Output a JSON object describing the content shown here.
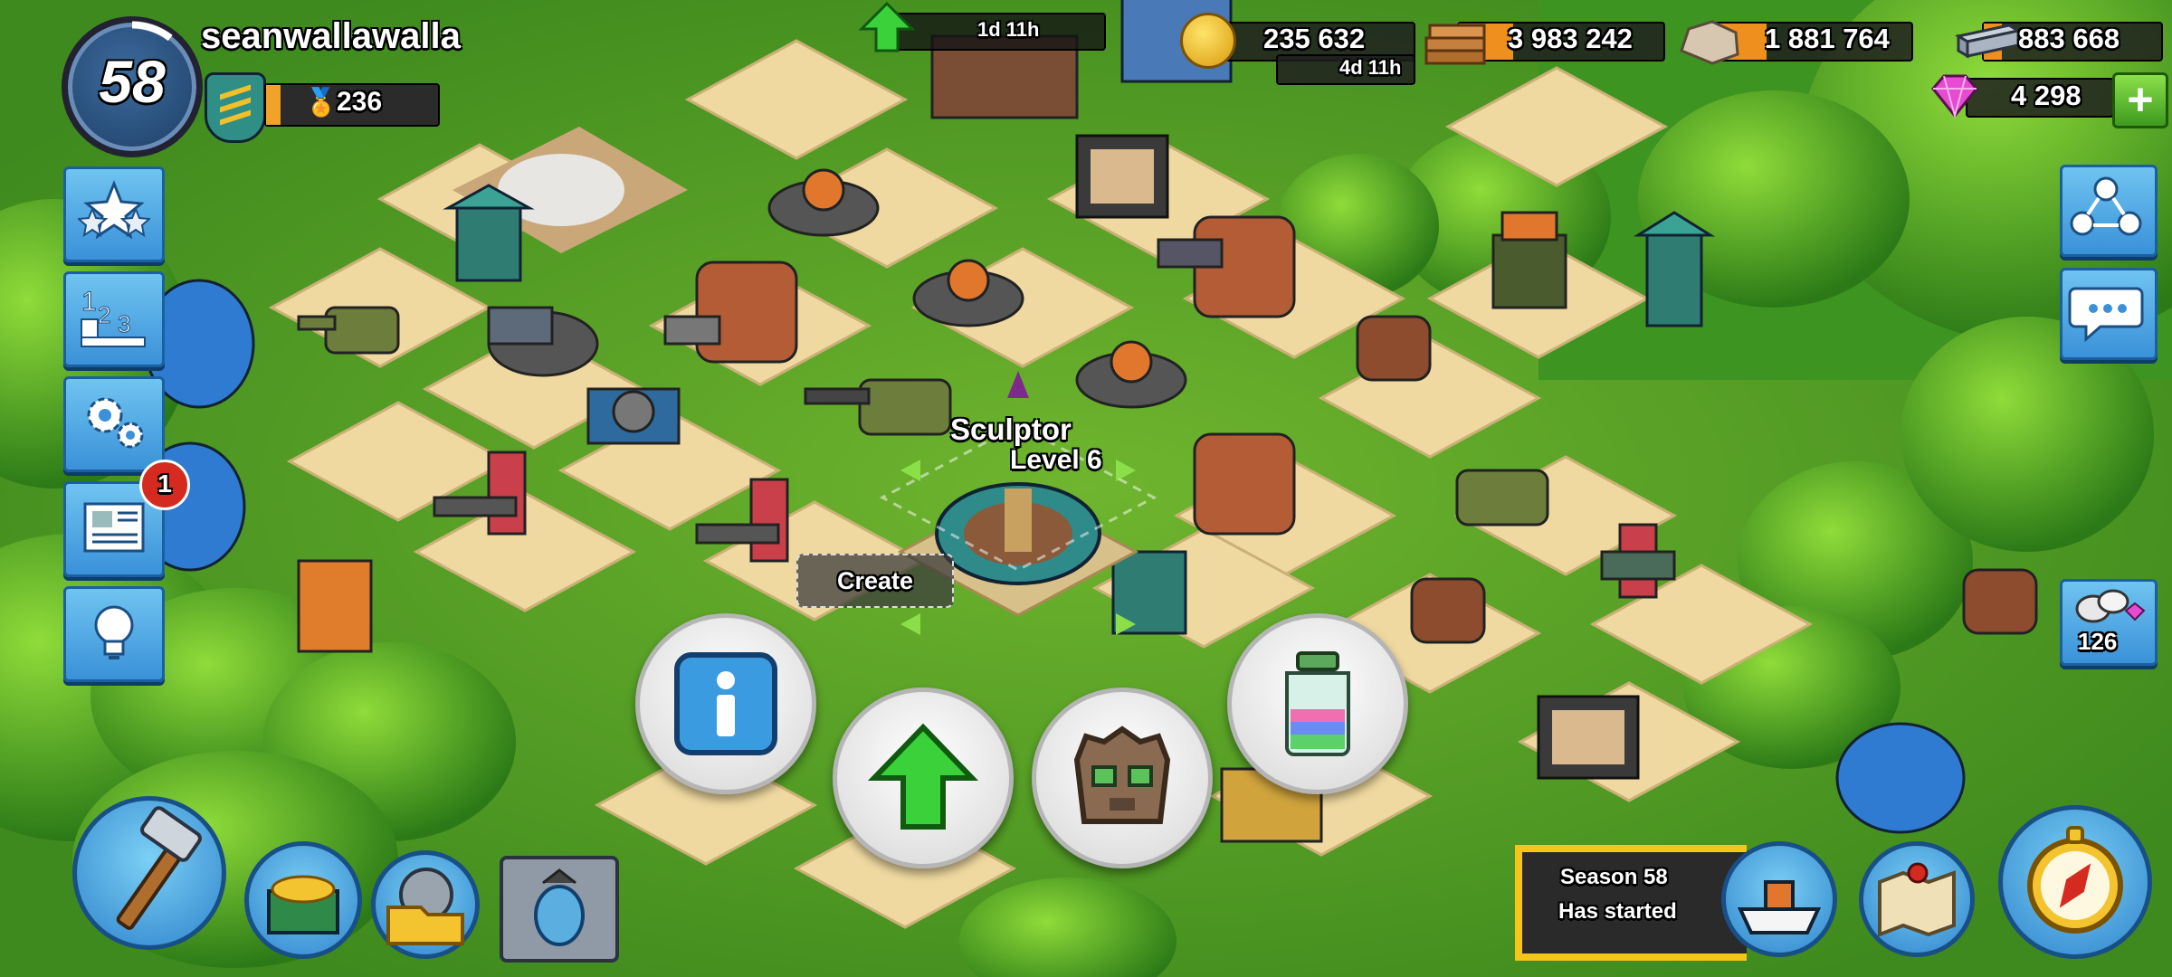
{
  "player": {
    "level": "58",
    "name": "seanwallawalla",
    "rank_value": "236"
  },
  "resources": {
    "timer_top": "1d 11h",
    "gold": "235 632",
    "gold_timer": "4d 11h",
    "wood": "3 983 242",
    "stone": "1 881 764",
    "iron": "883 668",
    "diamonds": "4 298"
  },
  "left_menu": {
    "news_badge": "1"
  },
  "building": {
    "name": "Sculptor",
    "level": "Level 6",
    "create_label": "Create"
  },
  "right_menu": {
    "power_stone_count": "126"
  },
  "season": {
    "line1": "Season 58",
    "line2": "Has started"
  },
  "colors": {
    "grass": "#4f9a26",
    "sand": "#efd9a0",
    "button_blue": "#3a91d8",
    "accent_orange": "#ef8f1d",
    "season_yellow": "#f5c51a"
  }
}
